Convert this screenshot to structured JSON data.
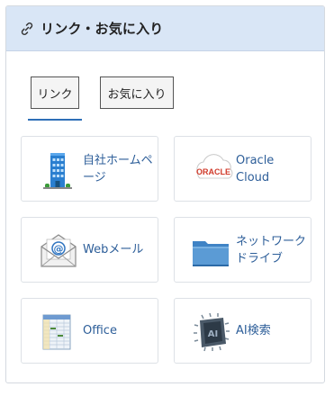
{
  "header": {
    "title": "リンク・お気に入り",
    "icon": "link-icon"
  },
  "tabs": [
    {
      "label": "リンク",
      "active": true
    },
    {
      "label": "お気に入り",
      "active": false
    }
  ],
  "tiles": [
    {
      "label": "自社ホームページ",
      "icon": "building-icon"
    },
    {
      "label": "Oracle Cloud",
      "icon": "oracle-cloud-icon",
      "logo_text": "ORACLE"
    },
    {
      "label": "Webメール",
      "icon": "mail-icon"
    },
    {
      "label": "ネットワークドライブ",
      "icon": "folder-icon"
    },
    {
      "label": "Office",
      "icon": "spreadsheet-icon"
    },
    {
      "label": "AI検索",
      "icon": "ai-chip-icon",
      "chip_text": "AI"
    }
  ],
  "colors": {
    "header_bg": "#d9e6f6",
    "accent": "#2e6fb7",
    "link_text": "#2d5e99"
  }
}
